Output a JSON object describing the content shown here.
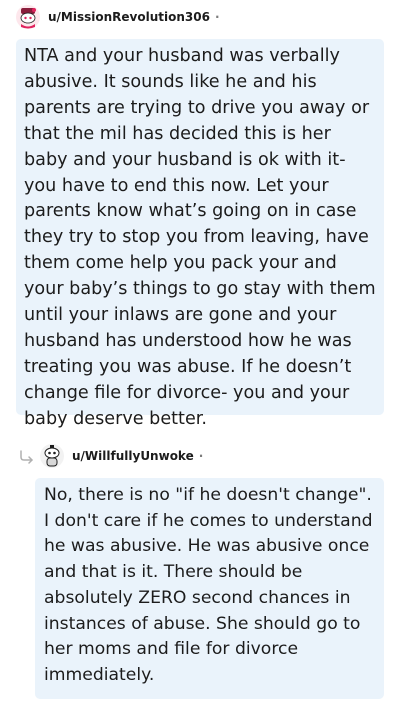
{
  "comments": [
    {
      "username": "u/MissionRevolution306",
      "separator": "·",
      "avatar": "reddit-snoo-avatar-red",
      "body": "NTA and your husband was verbally abusive. It sounds like he and his parents are trying to drive you away or that the mil has decided this is her baby and your husband is ok with it- you have to end this now. Let your parents know what’s going on in case they try to stop you from leaving, have them come help you pack your and your baby’s things to go stay with them until your inlaws are gone and your husband has understood how he was treating you was abuse. If he doesn’t change file for divorce- you and your baby deserve better."
    },
    {
      "username": "u/WillfullyUnwoke",
      "separator": "·",
      "avatar": "reddit-snoo-avatar-gray",
      "is_reply": true,
      "reply_icon": "reply-arrow-icon",
      "body": "No, there is no \"if he doesn't change\". I don't care if he comes to understand he was abusive. He was abusive once and that is it. There should be absolutely ZERO second chances in instances of abuse. She should go to her moms and file for divorce immediately."
    }
  ],
  "colors": {
    "bubble_background": "#eaf3fb",
    "text": "#1c1c1c",
    "meta": "#7c7c7c"
  }
}
